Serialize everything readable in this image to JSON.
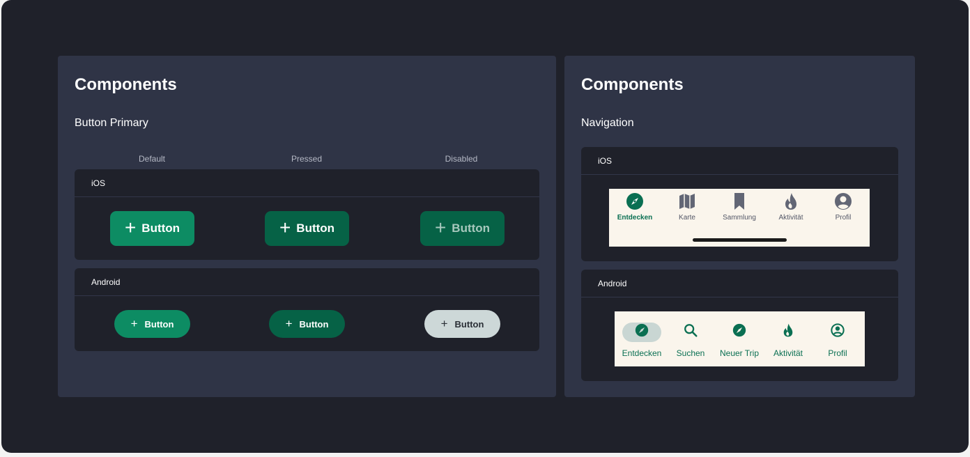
{
  "left_panel": {
    "title": "Components",
    "section": "Button Primary",
    "columns": [
      "Default",
      "Pressed",
      "Disabled"
    ],
    "ios": {
      "label": "iOS",
      "buttons": [
        {
          "state": "Default",
          "label": "Button",
          "icon": "plus-icon",
          "bg": "#0d8c63",
          "fg": "#ffffff"
        },
        {
          "state": "Pressed",
          "label": "Button",
          "icon": "plus-icon",
          "bg": "#066246",
          "fg": "#ffffff"
        },
        {
          "state": "Disabled",
          "label": "Button",
          "icon": "plus-icon",
          "bg": "#066246",
          "fg": "#a7c8bd"
        }
      ]
    },
    "android": {
      "label": "Android",
      "buttons": [
        {
          "state": "Default",
          "label": "Button",
          "icon": "plus-icon",
          "bg": "#0d8c63",
          "fg": "#ffffff"
        },
        {
          "state": "Pressed",
          "label": "Button",
          "icon": "plus-icon",
          "bg": "#066246",
          "fg": "#ffffff"
        },
        {
          "state": "Disabled",
          "label": "Button",
          "icon": "plus-icon",
          "bg": "#cdd8d8",
          "fg": "#2a2f36"
        }
      ]
    }
  },
  "right_panel": {
    "title": "Components",
    "section": "Navigation",
    "ios": {
      "label": "iOS",
      "items": [
        {
          "label": "Entdecken",
          "icon": "compass-icon",
          "active": true
        },
        {
          "label": "Karte",
          "icon": "map-icon",
          "active": false
        },
        {
          "label": "Sammlung",
          "icon": "bookmark-icon",
          "active": false
        },
        {
          "label": "Aktivität",
          "icon": "flame-icon",
          "active": false
        },
        {
          "label": "Profil",
          "icon": "profile-icon",
          "active": false
        }
      ]
    },
    "android": {
      "label": "Android",
      "items": [
        {
          "label": "Entdecken",
          "icon": "compass-icon",
          "active": true
        },
        {
          "label": "Suchen",
          "icon": "search-icon",
          "active": false
        },
        {
          "label": "Neuer Trip",
          "icon": "compass-icon",
          "active": false
        },
        {
          "label": "Aktivität",
          "icon": "flame-icon",
          "active": false
        },
        {
          "label": "Profil",
          "icon": "profile-icon",
          "active": false
        }
      ]
    }
  },
  "colors": {
    "background": "#1f212a",
    "panel": "#2f3446",
    "brand_green": "#0a6f52",
    "nav_bg": "#faf5ec",
    "inactive_icon": "#626675"
  }
}
